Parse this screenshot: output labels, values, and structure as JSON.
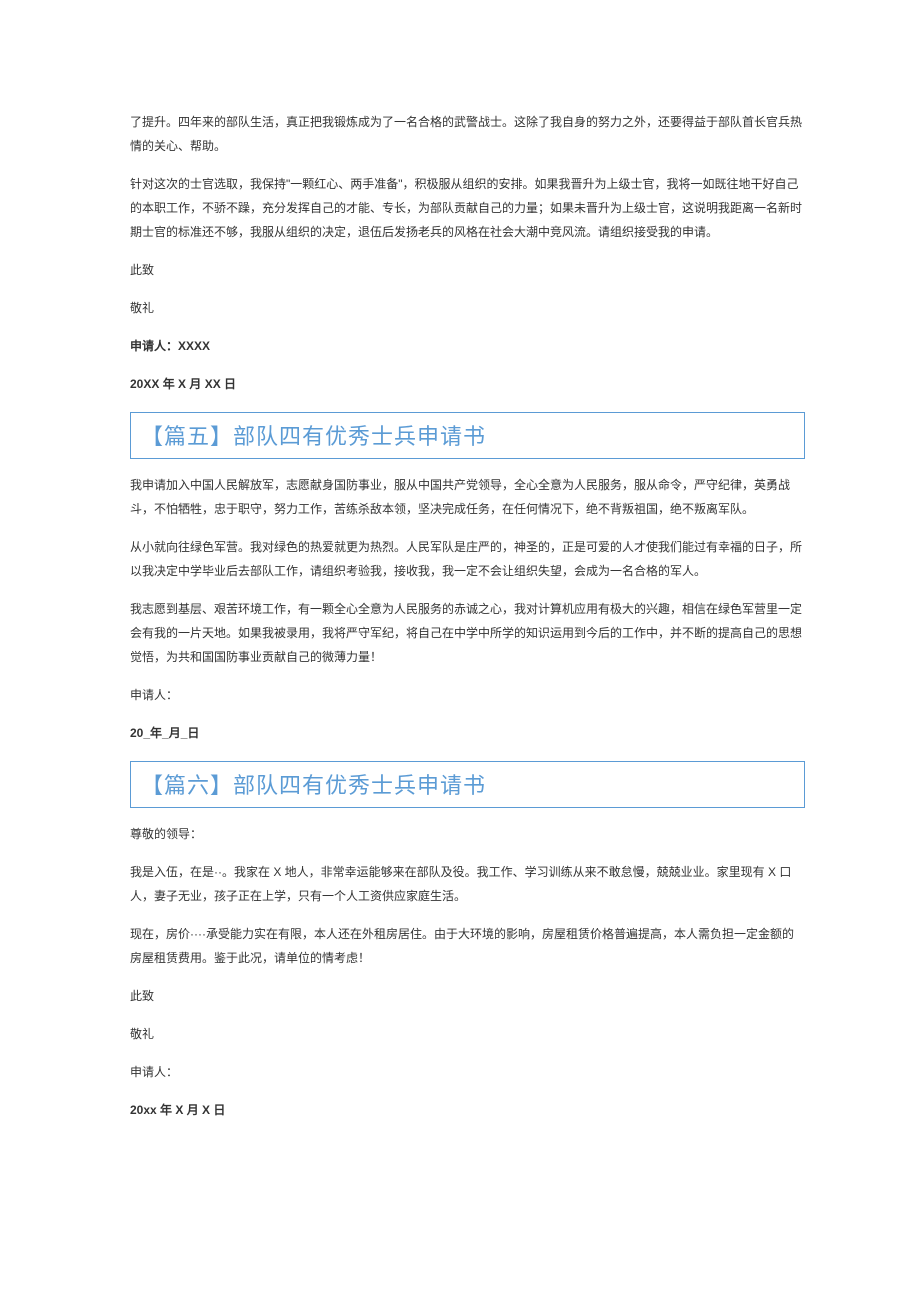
{
  "section4": {
    "p1": "了提升。四年来的部队生活，真正把我锻炼成为了一名合格的武警战士。这除了我自身的努力之外，还要得益于部队首长官兵热情的关心、帮助。",
    "p2": "针对这次的士官选取，我保持\"一颗红心、两手准备\"，积极服从组织的安排。如果我晋升为上级士官，我将一如既往地干好自己的本职工作，不骄不躁，充分发挥自己的才能、专长，为部队贡献自己的力量；如果未晋升为上级士官，这说明我距离一名新时期士官的标准还不够，我服从组织的决定，退伍后发扬老兵的风格在社会大潮中竞风流。请组织接受我的申请。",
    "p3": "此致",
    "p4": "敬礼",
    "p5": "申请人：XXXX",
    "p6": "20XX 年 X 月 XX 日"
  },
  "section5": {
    "title": "【篇五】部队四有优秀士兵申请书",
    "p1": "我申请加入中国人民解放军，志愿献身国防事业，服从中国共产党领导，全心全意为人民服务，服从命令，严守纪律，英勇战斗，不怕牺牲，忠于职守，努力工作，苦练杀敌本领，坚决完成任务，在任何情况下，绝不背叛祖国，绝不叛离军队。",
    "p2": "从小就向往绿色军营。我对绿色的热爱就更为热烈。人民军队是庄严的，神圣的，正是可爱的人才使我们能过有幸福的日子，所以我决定中学毕业后去部队工作，请组织考验我，接收我，我一定不会让组织失望，会成为一名合格的军人。",
    "p3": "我志愿到基层、艰苦环境工作，有一颗全心全意为人民服务的赤诚之心，我对计算机应用有极大的兴趣，相信在绿色军营里一定会有我的一片天地。如果我被录用，我将严守军纪，将自己在中学中所学的知识运用到今后的工作中，并不断的提高自己的思想觉悟，为共和国国防事业贡献自己的微薄力量！",
    "p4": "申请人：",
    "p5": "20_年_月_日"
  },
  "section6": {
    "title": "【篇六】部队四有优秀士兵申请书",
    "p1": "尊敬的领导：",
    "p2": "我是入伍，在是··。我家在 X 地人，非常幸运能够来在部队及役。我工作、学习训练从来不敢怠慢，兢兢业业。家里现有 X 口人，妻子无业，孩子正在上学，只有一个人工资供应家庭生活。",
    "p3": "现在，房价····承受能力实在有限，本人还在外租房居住。由于大环境的影响，房屋租赁价格普遍提高，本人需负担一定金额的房屋租赁费用。鉴于此况，请单位的情考虑！",
    "p4": "此致",
    "p5": "敬礼",
    "p6": "申请人：",
    "p7": "20xx 年 X 月 X 日"
  }
}
